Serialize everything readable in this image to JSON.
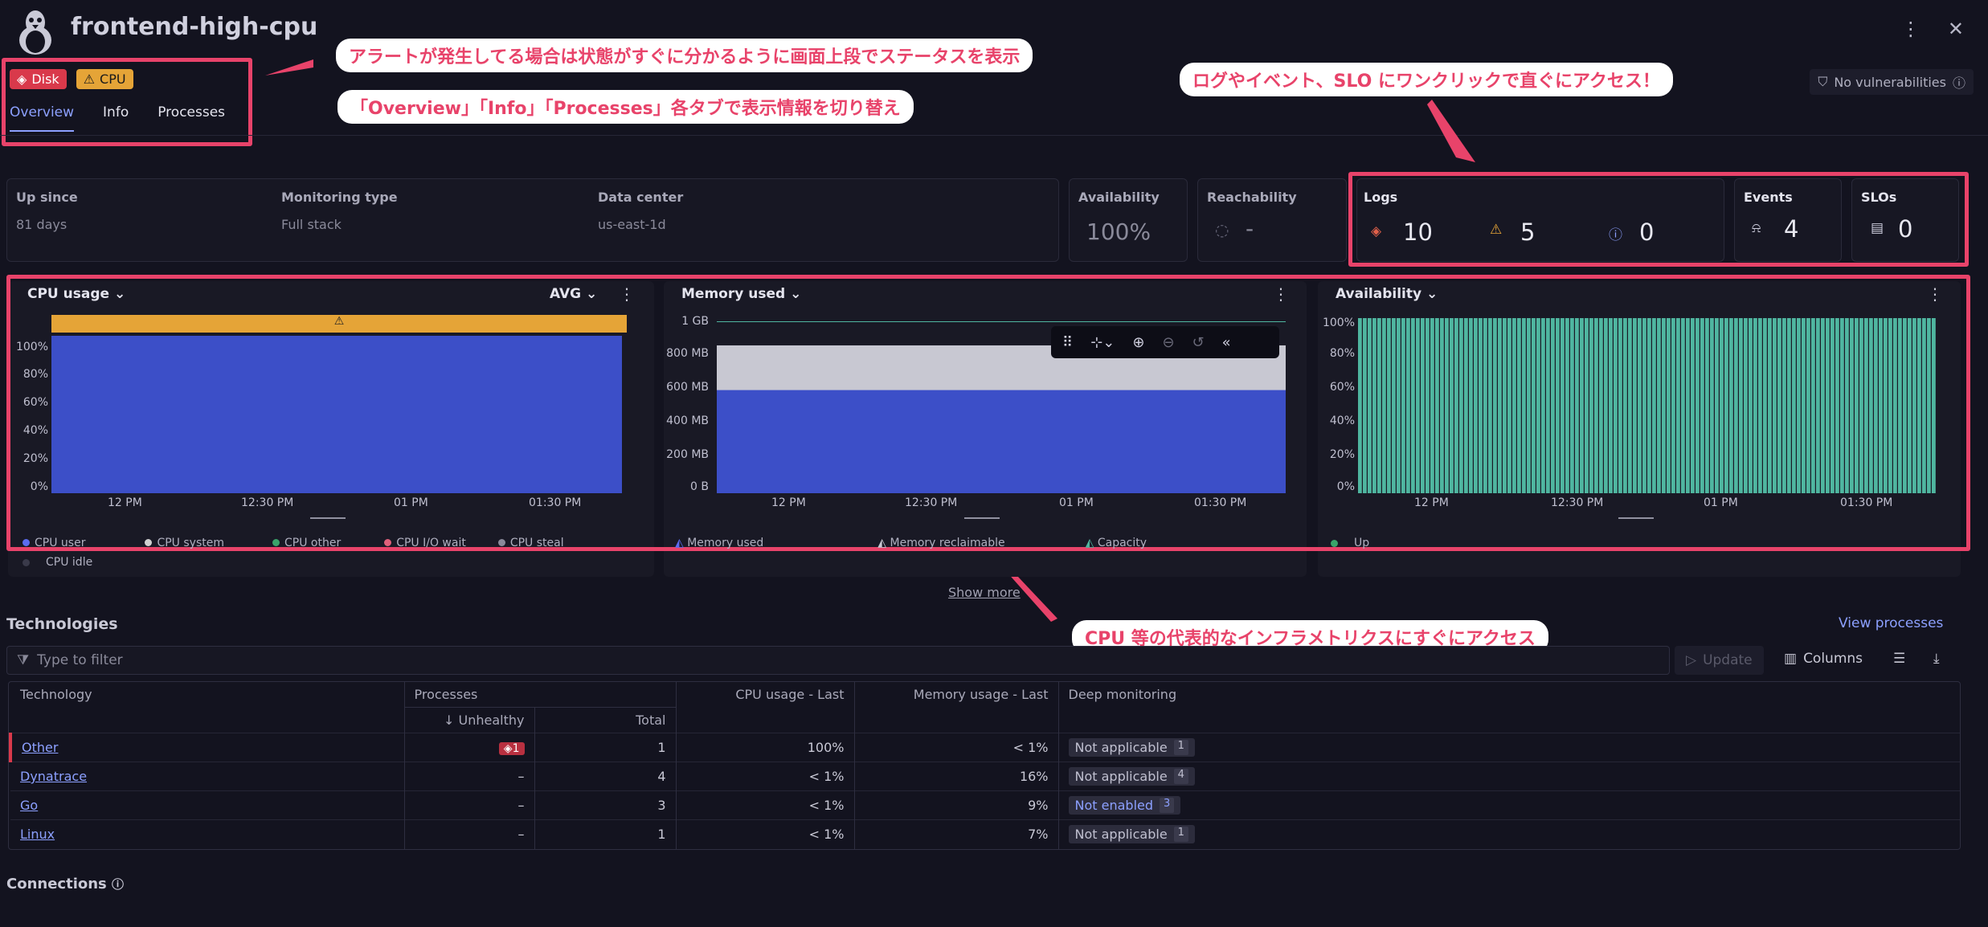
{
  "header": {
    "title": "frontend-high-cpu",
    "vulnerabilities": "No vulnerabilities"
  },
  "badges": {
    "disk": "Disk",
    "cpu": "CPU"
  },
  "tabs": [
    "Overview",
    "Info",
    "Processes"
  ],
  "info": {
    "up_since_label": "Up since",
    "up_since_value": "81 days",
    "monitoring_label": "Monitoring type",
    "monitoring_value": "Full stack",
    "datacenter_label": "Data center",
    "datacenter_value": "us-east-1d",
    "availability_label": "Availability",
    "availability_value": "100%",
    "reachability_label": "Reachability",
    "reachability_value": "-"
  },
  "kpis": {
    "logs_label": "Logs",
    "logs_error": "10",
    "logs_warn": "5",
    "logs_info": "0",
    "events_label": "Events",
    "events_value": "4",
    "slos_label": "SLOs",
    "slos_value": "0"
  },
  "callouts": {
    "c1": "アラートが発生してる場合は状態がすぐに分かるように画面上段でステータスを表示",
    "c2": "「Overview」「Info」「Processes」各タブで表示情報を切り替え",
    "c3": "ログやイベント、SLO にワンクリックで直ぐにアクセス！",
    "c4": "CPU 等の代表的なインフラメトリクスにすぐにアクセス"
  },
  "charts": {
    "cpu": {
      "title": "CPU usage",
      "agg": "AVG",
      "yticks": [
        "100%",
        "80%",
        "60%",
        "40%",
        "20%",
        "0%"
      ],
      "xticks": [
        "12 PM",
        "12:30 PM",
        "01 PM",
        "01:30 PM"
      ],
      "legend": [
        "CPU user",
        "CPU system",
        "CPU other",
        "CPU I/O wait",
        "CPU steal",
        "CPU idle"
      ],
      "value_pct": 100
    },
    "mem": {
      "title": "Memory used",
      "yticks": [
        "1 GB",
        "800 MB",
        "600 MB",
        "400 MB",
        "200 MB",
        "0 B"
      ],
      "xticks": [
        "12 PM",
        "12:30 PM",
        "01 PM",
        "01:30 PM"
      ],
      "legend": [
        "Memory used",
        "Memory reclaimable",
        "Capacity"
      ],
      "used_mb": 600,
      "total_mb": 860,
      "capacity_mb": 1000
    },
    "avail": {
      "title": "Availability",
      "yticks": [
        "100%",
        "80%",
        "60%",
        "40%",
        "20%",
        "0%"
      ],
      "xticks": [
        "12 PM",
        "12:30 PM",
        "01 PM",
        "01:30 PM"
      ],
      "legend": [
        "Up"
      ],
      "value_pct": 100
    }
  },
  "show_more": "Show more",
  "technologies": {
    "title": "Technologies",
    "view_processes": "View processes",
    "filter_placeholder": "Type to filter",
    "update": "Update",
    "columns": "Columns",
    "headers": {
      "technology": "Technology",
      "processes": "Processes",
      "unhealthy": "Unhealthy",
      "total": "Total",
      "cpu": "CPU usage - Last",
      "memory": "Memory usage - Last",
      "deep": "Deep monitoring"
    },
    "rows": [
      {
        "tech": "Other",
        "unhealthy": "1",
        "total": "1",
        "cpu": "100%",
        "memory": "< 1%",
        "deep": "Not applicable",
        "deep_n": "1"
      },
      {
        "tech": "Dynatrace",
        "unhealthy": "–",
        "total": "4",
        "cpu": "< 1%",
        "memory": "16%",
        "deep": "Not applicable",
        "deep_n": "4"
      },
      {
        "tech": "Go",
        "unhealthy": "–",
        "total": "3",
        "cpu": "< 1%",
        "memory": "9%",
        "deep": "Not enabled",
        "deep_n": "3"
      },
      {
        "tech": "Linux",
        "unhealthy": "–",
        "total": "1",
        "cpu": "< 1%",
        "memory": "7%",
        "deep": "Not applicable",
        "deep_n": "1"
      }
    ]
  },
  "connections": "Connections",
  "colors": {
    "accent": "#8ca0ff",
    "highlight": "#e8436a",
    "cpu_fill": "#3c4fc8",
    "avail_fill": "#4fb6a0",
    "warn": "#e5a437"
  }
}
